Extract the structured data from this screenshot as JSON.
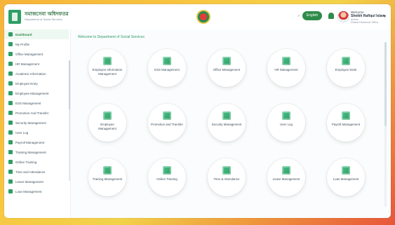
{
  "header": {
    "brand_title": "সমাজসেবা অধিদফতর",
    "brand_sub": "Department of Social Services",
    "search_icon": "search-icon",
    "language_button": "English",
    "bell_icon": "bell-icon",
    "user_welcome": "Welcome",
    "user_name": "Sheikh Rafiqul Islam",
    "user_role": "Admin",
    "user_office": "Dhaka Divisional Office",
    "caret_icon": "chevron-down-icon"
  },
  "sidebar": {
    "items": [
      {
        "label": "Dashboard"
      },
      {
        "label": "My Profile"
      },
      {
        "label": "Office Management"
      },
      {
        "label": "HR Management"
      },
      {
        "label": "Academic Information"
      },
      {
        "label": "Employee Entry"
      },
      {
        "label": "Employee Management"
      },
      {
        "label": "ESS Management"
      },
      {
        "label": "Promotion And Transfer"
      },
      {
        "label": "Security Management"
      },
      {
        "label": "User Log"
      },
      {
        "label": "Payroll Management"
      },
      {
        "label": "Training Management"
      },
      {
        "label": "Online Training"
      },
      {
        "label": "Time and Attendance"
      },
      {
        "label": "Leave Management"
      },
      {
        "label": "Loan Management"
      }
    ]
  },
  "main": {
    "welcome": "Welcome to Department of Social Services",
    "cards": [
      {
        "label": "Employee Information Management"
      },
      {
        "label": "ESS Management"
      },
      {
        "label": "Office Management"
      },
      {
        "label": "HR Management"
      },
      {
        "label": "Employee Desk"
      },
      {
        "label": "Employee Management"
      },
      {
        "label": "Promotion and Transfer"
      },
      {
        "label": "Security Management"
      },
      {
        "label": "User Log"
      },
      {
        "label": "Payroll Management"
      },
      {
        "label": "Training Management"
      },
      {
        "label": "Online Training"
      },
      {
        "label": "Time & Attendance"
      },
      {
        "label": "Leave Management"
      },
      {
        "label": "Loan Management"
      }
    ]
  },
  "colors": {
    "accent": "#2f9e63",
    "accent_dark": "#2f8b49"
  }
}
